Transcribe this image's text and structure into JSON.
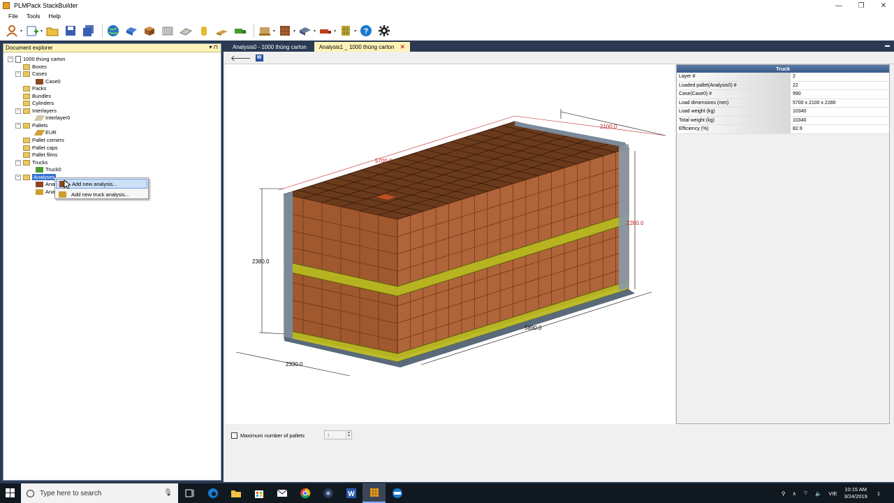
{
  "window": {
    "title": "PLMPack StackBuilder",
    "minimize": "—",
    "maximize": "❐",
    "close": "✕"
  },
  "menu": {
    "file": "File",
    "tools": "Tools",
    "help": "Help"
  },
  "explorer": {
    "title": "Document explorer",
    "pin": "▾ ⊓",
    "root": "1000 thùng carton",
    "nodes": {
      "boxes": "Boxes",
      "cases": "Cases",
      "case0": "Case0",
      "packs": "Packs",
      "bundles": "Bundles",
      "cylinders": "Cylinders",
      "interlayers": "Interlayers",
      "interlayer0": "Interlayer0",
      "pallets": "Pallets",
      "eur": "EUR",
      "pallet_corners": "Pallet corners",
      "pallet_caps": "Pallet caps",
      "pallet_films": "Pallet films",
      "trucks": "Trucks",
      "truck0": "Truck0",
      "analyses": "Analyses",
      "analysis_a": "Analy",
      "analysis_b": "Analy"
    },
    "context_menu": {
      "add_analysis": "Add new analysis...",
      "add_truck_analysis": "Add new truck analysis..."
    }
  },
  "tabs": [
    {
      "label": "Analysis0 - 1000 thùng carton",
      "active": false
    },
    {
      "label": "Analysis1 _ 1000 thùng carton",
      "active": true
    }
  ],
  "tab_close": "✕",
  "subtoolbar": {
    "back": "🡐",
    "word": "W"
  },
  "scene": {
    "dims": {
      "width_top": "2100.0",
      "length_top": "5700.0",
      "height_right": "2280.0",
      "height_left": "2380.0",
      "length_bottom": "5890.0",
      "width_bottom": "2330.0"
    }
  },
  "properties": {
    "header": "Truck",
    "rows": [
      {
        "key": "Layer #",
        "value": "2"
      },
      {
        "key": "Loaded pallet(Analysis0) #",
        "value": "22"
      },
      {
        "key": "Case(Case0) #",
        "value": "990"
      },
      {
        "key": "Load dimensions (mm)",
        "value": "5700 x 2100 x 2280"
      },
      {
        "key": "Load weight (kg)",
        "value": "10340"
      },
      {
        "key": "Total weight (kg)",
        "value": "10340"
      },
      {
        "key": "Efficiency (%)",
        "value": "82.9"
      }
    ]
  },
  "options": {
    "max_pallets_label": "Maximum number of pallets",
    "max_pallets_value": "1",
    "max_pallets_checked": false
  },
  "taskbar": {
    "search_placeholder": "Type here to search",
    "lang": "VIE",
    "time": "10:15 AM",
    "date": "3/24/2019",
    "notif": "1"
  }
}
